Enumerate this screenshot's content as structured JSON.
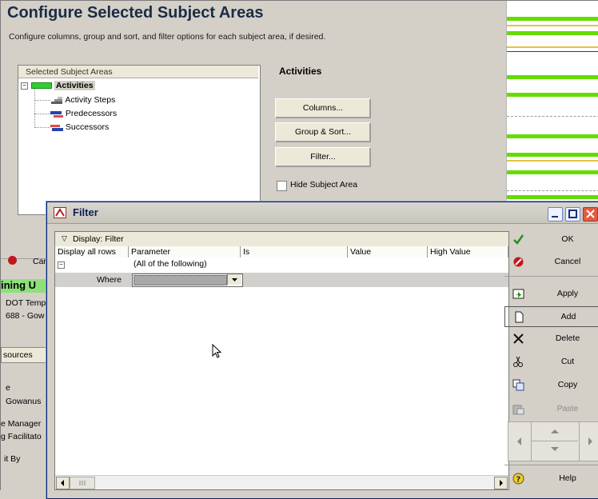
{
  "window": {
    "title": "Configure Selected Subject Areas",
    "description": "Configure columns, group and sort, and filter options for each subject area, if desired."
  },
  "subject_tree": {
    "header": "Selected Subject Areas",
    "root": "Activities",
    "children": [
      "Activity Steps",
      "Predecessors",
      "Successors"
    ]
  },
  "subject_config": {
    "title": "Activities",
    "columns_button": "Columns...",
    "group_sort_button": "Group & Sort...",
    "filter_button": "Filter...",
    "hide_label": "Hide Subject Area"
  },
  "background_partial": {
    "cancel": "Car",
    "project_title": "ining U",
    "line1": "DOT Temp",
    "line2": "688 - Gow",
    "tab": "sources",
    "field_e": "e",
    "gowanus": "Gowanus",
    "manager": "e Manager",
    "facilitator": "g Facilitato",
    "by": "it By"
  },
  "filter_dialog": {
    "title": "Filter",
    "display_label": "Display: Filter",
    "columns": [
      "Display all rows",
      "Parameter",
      "Is",
      "Value",
      "High Value"
    ],
    "row1_parameter": "(All of the following)",
    "row2_label": "Where",
    "row2_value": ""
  },
  "side_buttons": {
    "ok": "OK",
    "cancel": "Cancel",
    "apply": "Apply",
    "add": "Add",
    "delete": "Delete",
    "cut": "Cut",
    "copy": "Copy",
    "paste": "Paste",
    "help": "Help"
  },
  "icons": [
    "collapse-icon",
    "activity-icon",
    "steps-icon",
    "predecessors-icon",
    "successors-icon",
    "filter-icon",
    "minimize-icon",
    "maximize-icon",
    "close-icon",
    "check-icon",
    "cancel-icon",
    "apply-icon",
    "add-icon",
    "delete-icon",
    "cut-icon",
    "copy-icon",
    "paste-icon",
    "help-icon",
    "cursor-icon"
  ],
  "colors": {
    "green_bar": "#65dc00",
    "yellow_line": "#e3c442",
    "activity_green": "#2dd12f",
    "title_blue": "#1b2c45"
  }
}
